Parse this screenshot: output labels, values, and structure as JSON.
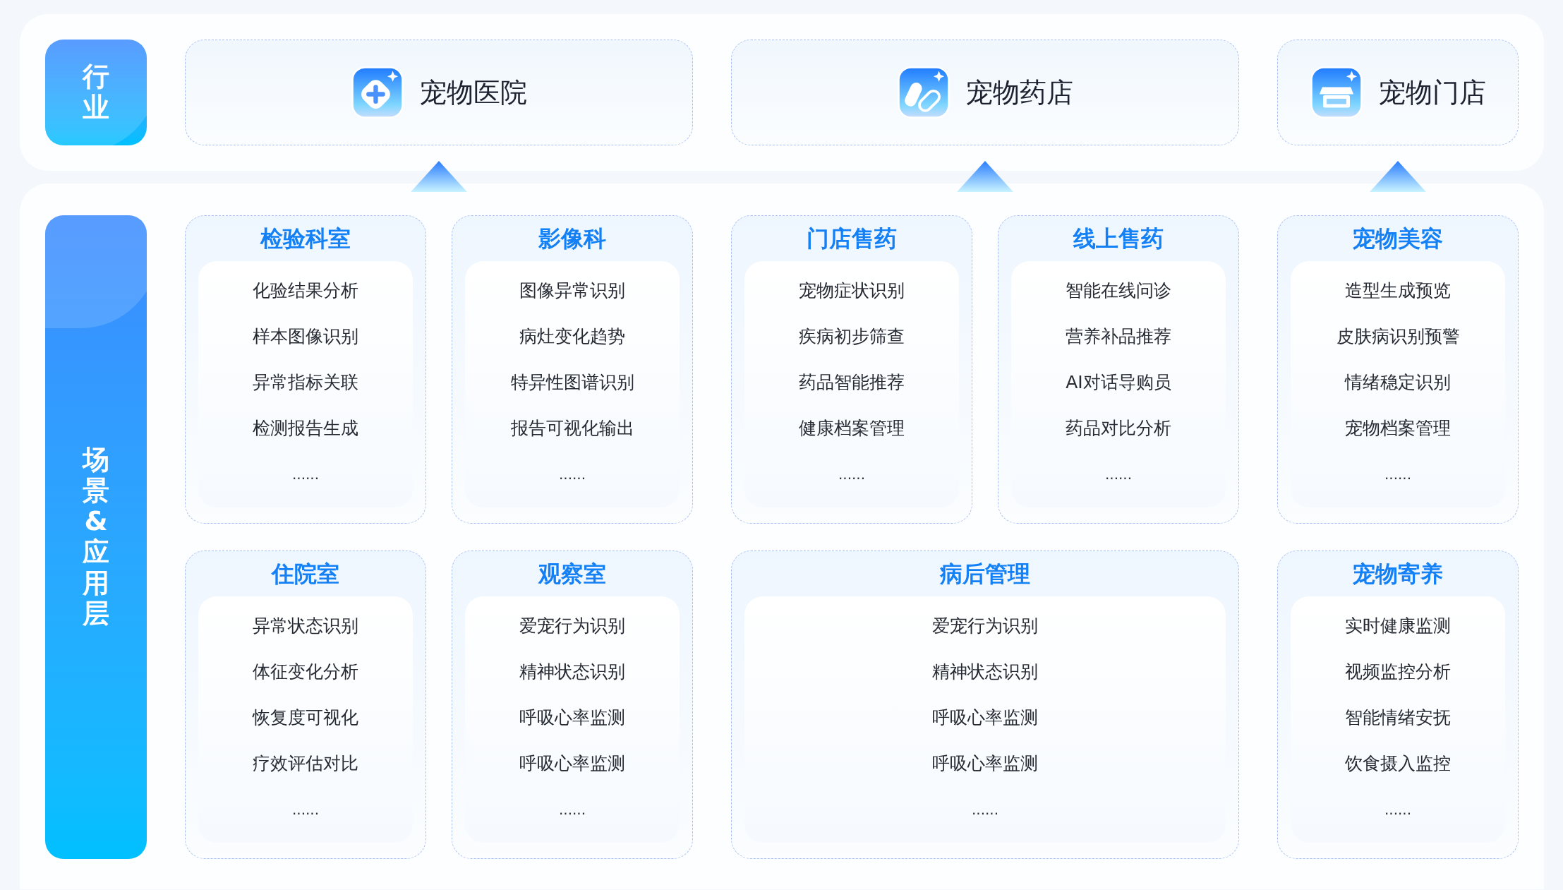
{
  "industry_label": "行业",
  "scene_label": "场景&应用层",
  "groups": [
    {
      "industry": {
        "name": "宠物医院"
      },
      "cards": [
        {
          "title": "检验科室",
          "wide": false,
          "items": [
            "化验结果分析",
            "样本图像识别",
            "异常指标关联",
            "检测报告生成"
          ],
          "more": "......"
        },
        {
          "title": "影像科",
          "wide": false,
          "items": [
            "图像异常识别",
            "病灶变化趋势",
            "特异性图谱识别",
            "报告可视化输出"
          ],
          "more": "......"
        },
        {
          "title": "住院室",
          "wide": false,
          "items": [
            "异常状态识别",
            "体征变化分析",
            "恢复度可视化",
            "疗效评估对比"
          ],
          "more": "......"
        },
        {
          "title": "观察室",
          "wide": false,
          "items": [
            "爱宠行为识别",
            "精神状态识别",
            "呼吸心率监测",
            "呼吸心率监测"
          ],
          "more": "......"
        }
      ]
    },
    {
      "industry": {
        "name": "宠物药店"
      },
      "cards": [
        {
          "title": "门店售药",
          "wide": false,
          "items": [
            "宠物症状识别",
            "疾病初步筛查",
            "药品智能推荐",
            "健康档案管理"
          ],
          "more": "......"
        },
        {
          "title": "线上售药",
          "wide": false,
          "items": [
            "智能在线问诊",
            "营养补品推荐",
            "AI对话导购员",
            "药品对比分析"
          ],
          "more": "......"
        },
        {
          "title": "病后管理",
          "wide": true,
          "items": [
            "爱宠行为识别",
            "精神状态识别",
            "呼吸心率监测",
            "呼吸心率监测"
          ],
          "more": "......"
        }
      ]
    },
    {
      "industry": {
        "name": "宠物门店"
      },
      "cards": [
        {
          "title": "宠物美容",
          "wide": false,
          "items": [
            "造型生成预览",
            "皮肤病识别预警",
            "情绪稳定识别",
            "宠物档案管理"
          ],
          "more": "......"
        },
        {
          "title": "宠物寄养",
          "wide": false,
          "items": [
            "实时健康监测",
            "视频监控分析",
            "智能情绪安抚",
            "饮食摄入监控"
          ],
          "more": "......"
        }
      ]
    }
  ]
}
